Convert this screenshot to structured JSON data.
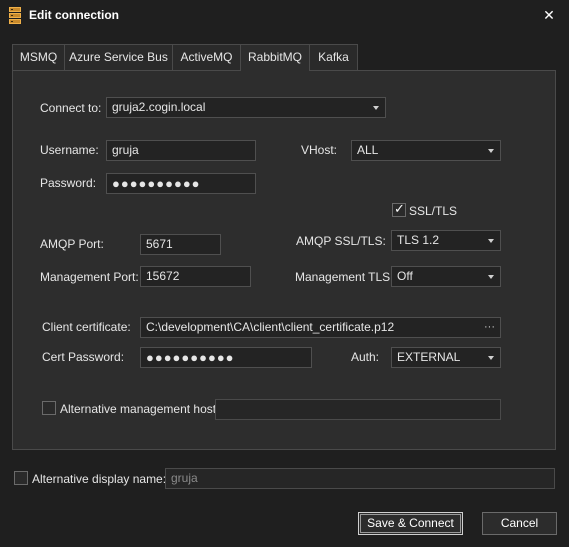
{
  "window": {
    "title": "Edit connection",
    "close_glyph": "✕",
    "app_icon": "server-stack-icon"
  },
  "tabs": [
    {
      "label": "MSMQ",
      "active": false
    },
    {
      "label": "Azure Service Bus",
      "active": false
    },
    {
      "label": "ActiveMQ",
      "active": false
    },
    {
      "label": "RabbitMQ",
      "active": true
    },
    {
      "label": "Kafka",
      "active": false
    }
  ],
  "form": {
    "connect_to": {
      "label": "Connect to:",
      "value": "gruja2.cogin.local"
    },
    "username": {
      "label": "Username:",
      "value": "gruja"
    },
    "vhost": {
      "label": "VHost:",
      "value": "ALL"
    },
    "password": {
      "label": "Password:",
      "value": "●●●●●●●●●●"
    },
    "ssl_tls": {
      "label": "SSL/TLS",
      "checked": true
    },
    "amqp_port": {
      "label": "AMQP Port:",
      "value": "5671"
    },
    "amqp_ssl": {
      "label": "AMQP SSL/TLS:",
      "value": "TLS 1.2"
    },
    "management_port": {
      "label": "Management Port:",
      "value": "15672"
    },
    "management_tls": {
      "label": "Management TLS:",
      "value": "Off"
    },
    "client_certificate": {
      "label": "Client certificate:",
      "value": "C:\\development\\CA\\client\\client_certificate.p12",
      "browse": "···"
    },
    "cert_password": {
      "label": "Cert Password:",
      "value": "●●●●●●●●●●"
    },
    "auth": {
      "label": "Auth:",
      "value": "EXTERNAL"
    },
    "alt_management_host": {
      "label": "Alternative management host:",
      "checked": false,
      "value": ""
    }
  },
  "alt_display_name": {
    "label": "Alternative display name:",
    "checked": false,
    "placeholder": "gruja"
  },
  "buttons": {
    "save": "Save & Connect",
    "cancel": "Cancel"
  }
}
